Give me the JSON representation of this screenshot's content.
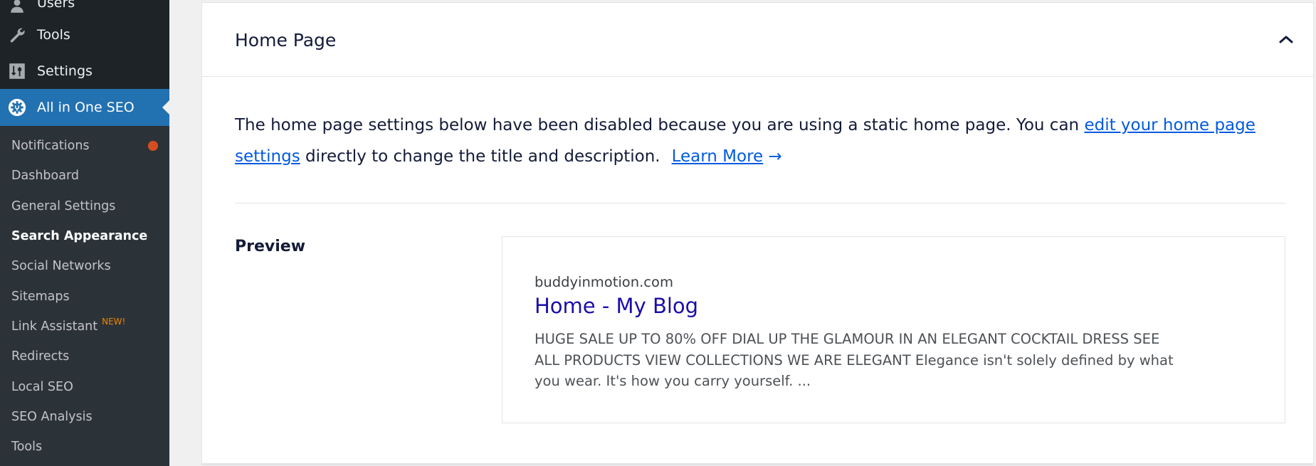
{
  "sidebar": {
    "top_menu": [
      {
        "label": "Users",
        "icon": "user-icon"
      },
      {
        "label": "Tools",
        "icon": "wrench-icon"
      },
      {
        "label": "Settings",
        "icon": "settings-sliders-icon"
      },
      {
        "label": "All in One SEO",
        "icon": "aioseo-gear-icon",
        "active": true
      }
    ],
    "submenu": [
      {
        "label": "Notifications",
        "has_dot": true
      },
      {
        "label": "Dashboard"
      },
      {
        "label": "General Settings"
      },
      {
        "label": "Search Appearance",
        "current": true
      },
      {
        "label": "Social Networks"
      },
      {
        "label": "Sitemaps"
      },
      {
        "label": "Link Assistant",
        "badge": "NEW!"
      },
      {
        "label": "Redirects"
      },
      {
        "label": "Local SEO"
      },
      {
        "label": "SEO Analysis"
      },
      {
        "label": "Tools"
      }
    ]
  },
  "card": {
    "title": "Home Page",
    "collapse_icon": "chevron-up-icon",
    "notice": {
      "text_before": "The home page settings below have been disabled because you are using a static home page. You can ",
      "link_edit": "edit your home page settings",
      "text_after": " directly to change the title and description.",
      "learn_more": "Learn More",
      "arrow": "→"
    },
    "preview": {
      "label": "Preview",
      "domain": "buddyinmotion.com",
      "title": "Home - My Blog",
      "description": "HUGE SALE UP TO 80% OFF DIAL UP THE GLAMOUR IN AN ELEGANT COCKTAIL DRESS SEE ALL PRODUCTS VIEW COLLECTIONS WE ARE ELEGANT Elegance isn't solely defined by what you wear. It's how you carry yourself. ..."
    }
  },
  "colors": {
    "accent": "#2271b1",
    "sidebar_bg": "#1d2327",
    "submenu_bg": "#2c3338",
    "notification_dot": "#d54e21",
    "new_badge": "#f18500",
    "link": "#005ae0",
    "serp_title": "#1a0dab"
  }
}
